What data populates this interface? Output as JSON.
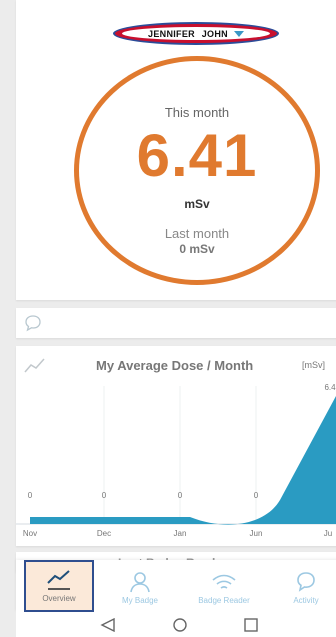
{
  "header": {
    "user_name": "JENNIFER JOHN",
    "caret_icon": "chevron-down-icon"
  },
  "dose": {
    "period_label": "This month",
    "value": "6.41",
    "unit": "mSv",
    "previous_label": "Last month",
    "previous_value": "0 mSv"
  },
  "comment": {
    "icon": "speech-bubble-icon"
  },
  "chart": {
    "icon": "trend-line-icon",
    "title": "My Average Dose / Month",
    "unit": "[mSv]"
  },
  "chart_data": {
    "type": "area",
    "title": "My Average Dose / Month",
    "ylabel": "[mSv]",
    "categories": [
      "Nov",
      "Dec",
      "Jan",
      "Jun",
      "Ju"
    ],
    "values": [
      0,
      0,
      0,
      0,
      6.41
    ],
    "value_labels": [
      "0",
      "0",
      "0",
      "0",
      "6.4"
    ],
    "ylim": [
      0,
      6.41
    ],
    "grid": true,
    "color": "#2a9bc2"
  },
  "next_card": {
    "label": "Last Badge Read"
  },
  "nav": {
    "items": [
      {
        "label": "Overview",
        "icon": "line-chart-icon",
        "active": true
      },
      {
        "label": "My Badge",
        "icon": "person-icon"
      },
      {
        "label": "Badge Reader",
        "icon": "wifi-icon"
      },
      {
        "label": "Activity",
        "icon": "speech-bubble-icon"
      }
    ]
  },
  "system": {
    "buttons": [
      "back-icon",
      "home-icon",
      "recents-icon"
    ]
  },
  "colors": {
    "accent": "#e07a2f",
    "chart_fill": "#2a9bc2",
    "nav_inactive": "#9cc8e2",
    "pill_outer": "#c8102e",
    "pill_border": "#2b4c99"
  }
}
